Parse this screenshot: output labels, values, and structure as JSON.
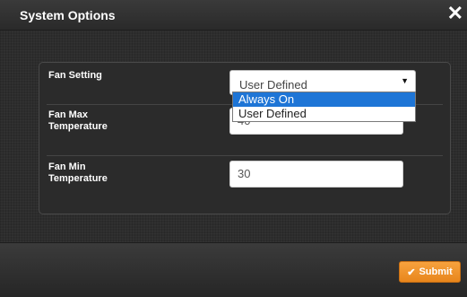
{
  "dialog": {
    "title": "System Options",
    "close_icon": "close-icon"
  },
  "fields": {
    "fan_setting": {
      "label": "Fan Setting",
      "selected": "User Defined",
      "options": [
        "Always On",
        "User Defined"
      ],
      "highlighted_option": "Always On"
    },
    "fan_max_temp": {
      "label": "Fan Max\nTemperature",
      "value": "40"
    },
    "fan_min_temp": {
      "label": "Fan Min\nTemperature",
      "value": "30"
    }
  },
  "footer": {
    "submit_label": "Submit",
    "submit_icon": "check-icon"
  },
  "colors": {
    "accent_orange": "#f39a34",
    "highlight_blue": "#1e75d6",
    "background_dark": "#2e2e2e"
  }
}
